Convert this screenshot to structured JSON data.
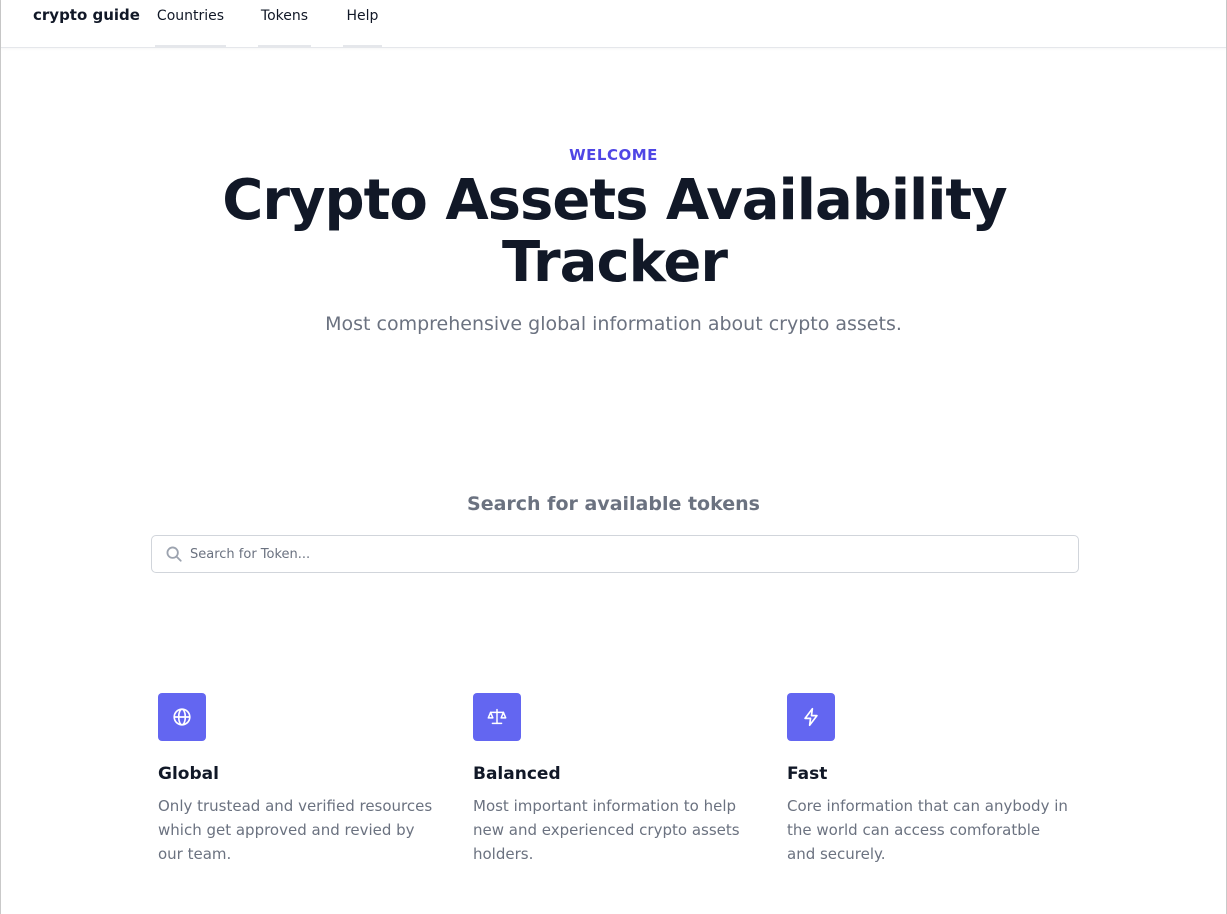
{
  "nav": {
    "brand": "crypto guide",
    "links": [
      "Countries",
      "Tokens",
      "Help"
    ]
  },
  "hero": {
    "eyebrow": "WELCOME",
    "title": "Crypto Assets Availability Tracker",
    "subtitle": "Most comprehensive global information about crypto assets."
  },
  "search": {
    "heading": "Search for available tokens",
    "placeholder": "Search for Token..."
  },
  "features": [
    {
      "icon": "globe-icon",
      "title": "Global",
      "description": "Only trustead and verified resources which get approved and revied by our team."
    },
    {
      "icon": "scale-icon",
      "title": "Balanced",
      "description": "Most important information to help new and experienced crypto assets holders."
    },
    {
      "icon": "lightning-icon",
      "title": "Fast",
      "description": "Core information that can anybody in the world can access comforatble and securely."
    }
  ],
  "colors": {
    "accent": "#4f46e5",
    "icon_bg": "#6366f1",
    "heading": "#111827",
    "muted": "#6b7280"
  }
}
